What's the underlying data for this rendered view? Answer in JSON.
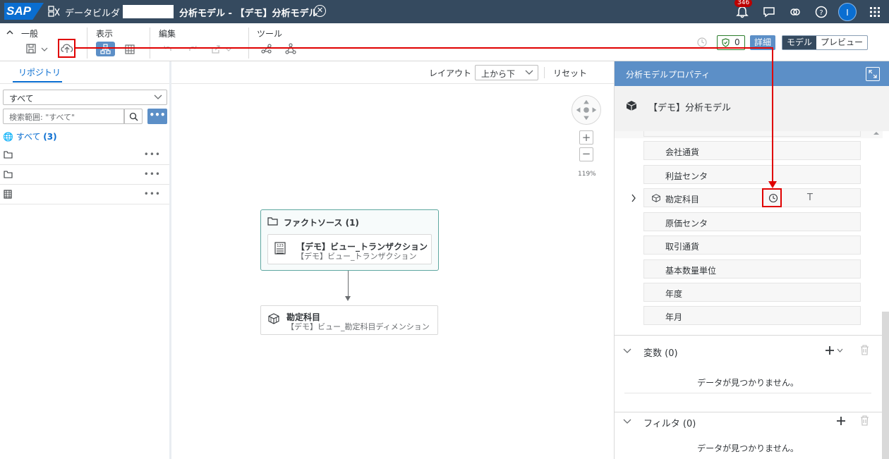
{
  "shell": {
    "logo": "SAP",
    "app_name": "データビルダ",
    "doc_title": "分析モデル - 【デモ】分析モデル",
    "notification_count": "346",
    "avatar_initial": "I"
  },
  "toolbar": {
    "group_general": "一般",
    "group_view": "表示",
    "group_edit": "編集",
    "group_tools": "ツール",
    "validation_count": "0",
    "details_label": "詳細",
    "mode_model": "モデル",
    "mode_preview": "プレビュー"
  },
  "repository": {
    "tab_label": "リポジトリ",
    "filter_value": "すべて",
    "search_placeholder": "検索範囲: \"すべて\"",
    "all_label": "すべて",
    "all_count": "(3)",
    "rows": [
      {
        "icon": "folder-icon"
      },
      {
        "icon": "folder-icon"
      },
      {
        "icon": "table-icon"
      }
    ]
  },
  "canvas": {
    "layout_label": "レイアウト",
    "layout_value": "上から下",
    "reset_label": "リセット",
    "zoom_level": "119%",
    "fact_source_title": "ファクトソース (1)",
    "fact_item_title": "【デモ】ビュー_トランザクション",
    "fact_item_subtitle": "【デモ】ビュー_トランザクション",
    "dimension_title": "勘定科目",
    "dimension_subtitle": "【デモ】ビュー_勘定科目ディメンション"
  },
  "properties": {
    "header": "分析モデルプロパティ",
    "model_name": "【デモ】分析モデル",
    "attributes": [
      "会社通貨",
      "利益センタ",
      "勘定科目",
      "原価センタ",
      "取引通貨",
      "基本数量単位",
      "年度",
      "年月"
    ],
    "highlight_type_text": "T",
    "variables_title": "変数 (0)",
    "variables_empty": "データが見つかりません。",
    "filter_title": "フィルタ (0)",
    "filter_empty": "データが見つかりません。"
  },
  "colors": {
    "shell_bg": "#354a5f",
    "accent": "#0a6ed1",
    "panel_header": "#5c8fc7",
    "annotation_red": "#e00000",
    "fact_border": "#5ea7a0"
  }
}
